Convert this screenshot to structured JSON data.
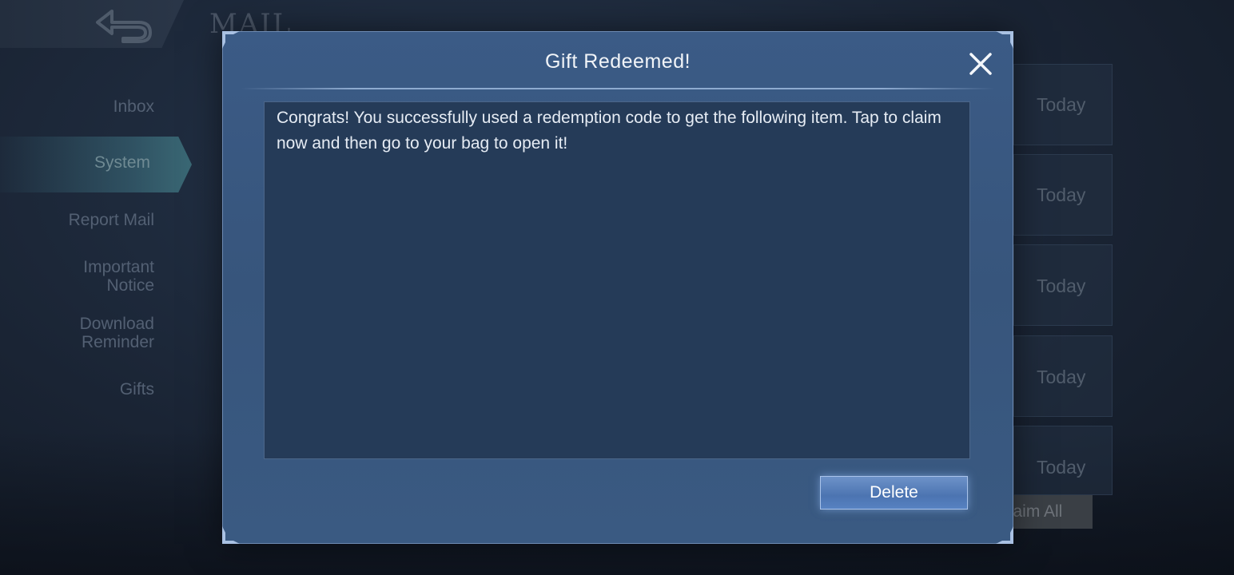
{
  "background": {
    "screen_title": "MAIL",
    "sidebar": {
      "items": [
        {
          "label": "Inbox"
        },
        {
          "label": "System",
          "active": true
        },
        {
          "label": "Report Mail"
        },
        {
          "label": "Important Notice"
        },
        {
          "label": "Download Reminder"
        },
        {
          "label": "Gifts"
        }
      ]
    },
    "mail_list": {
      "dates": [
        "Today",
        "Today",
        "Today",
        "Today",
        "Today"
      ]
    },
    "footer": {
      "claim_all_label": "Claim All"
    }
  },
  "dialog": {
    "title": "Gift Redeemed!",
    "message": "Congrats! You successfully used a redemption code to get the following item. Tap to claim now and then go to your bag to open it!",
    "delete_label": "Delete",
    "close_icon": "close-icon"
  },
  "colors": {
    "dialog_bg": "#3b5b86",
    "message_bg": "#253b58",
    "button_bg": "#4c74b1",
    "title_text": "#f1f4f8"
  }
}
